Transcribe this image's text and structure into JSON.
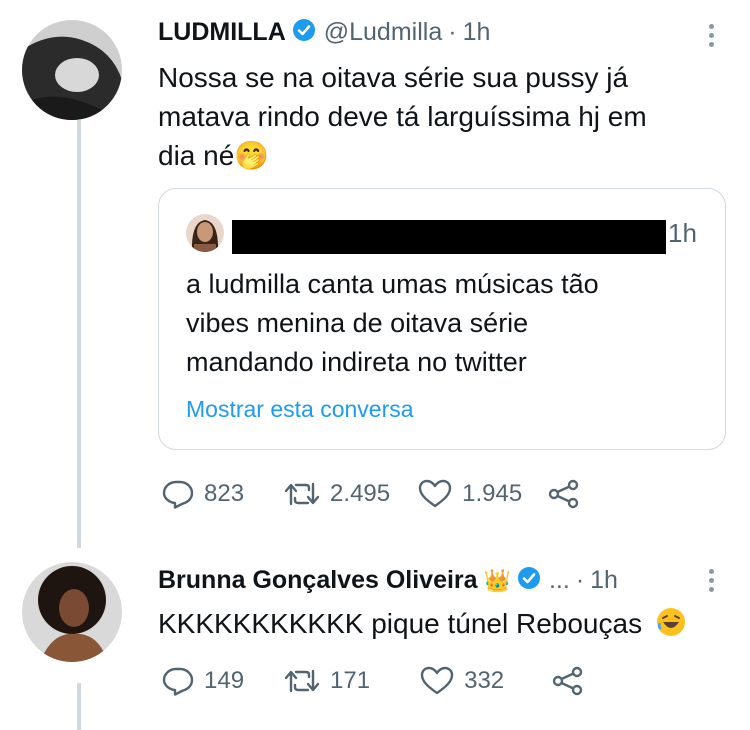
{
  "tweet1": {
    "name": "LUDMILLA",
    "handle": "@Ludmilla",
    "dot": "·",
    "time": "1h",
    "text_line1": "Nossa se na oitava série sua pussy já",
    "text_line2": "matava rindo deve tá larguíssima hj em",
    "text_line3": "dia né🤭",
    "quote": {
      "time": "1h",
      "text_line1": "a ludmilla canta umas músicas tão",
      "text_line2": "vibes menina de oitava série",
      "text_line3": "mandando indireta no twitter",
      "show_thread": "Mostrar esta conversa"
    },
    "replies": "823",
    "retweets": "2.495",
    "likes": "1.945"
  },
  "tweet2": {
    "name": "Brunna Gonçalves Oliveira",
    "crown": "👑",
    "ellipsis": "...",
    "dot": "·",
    "time": "1h",
    "text": "KKKKKKKKKKK pique túnel Rebouças",
    "replies": "149",
    "retweets": "171",
    "likes": "332"
  },
  "colors": {
    "text": "#0f1419",
    "secondary": "#536471",
    "link": "#1d9bf0",
    "verified": "#1d9bf0",
    "border": "#cfd9de"
  },
  "icons": [
    "verified-badge-icon",
    "more-options-icon",
    "reply-icon",
    "retweet-icon",
    "like-icon",
    "share-icon",
    "crown-icon",
    "laughing-face-icon"
  ]
}
